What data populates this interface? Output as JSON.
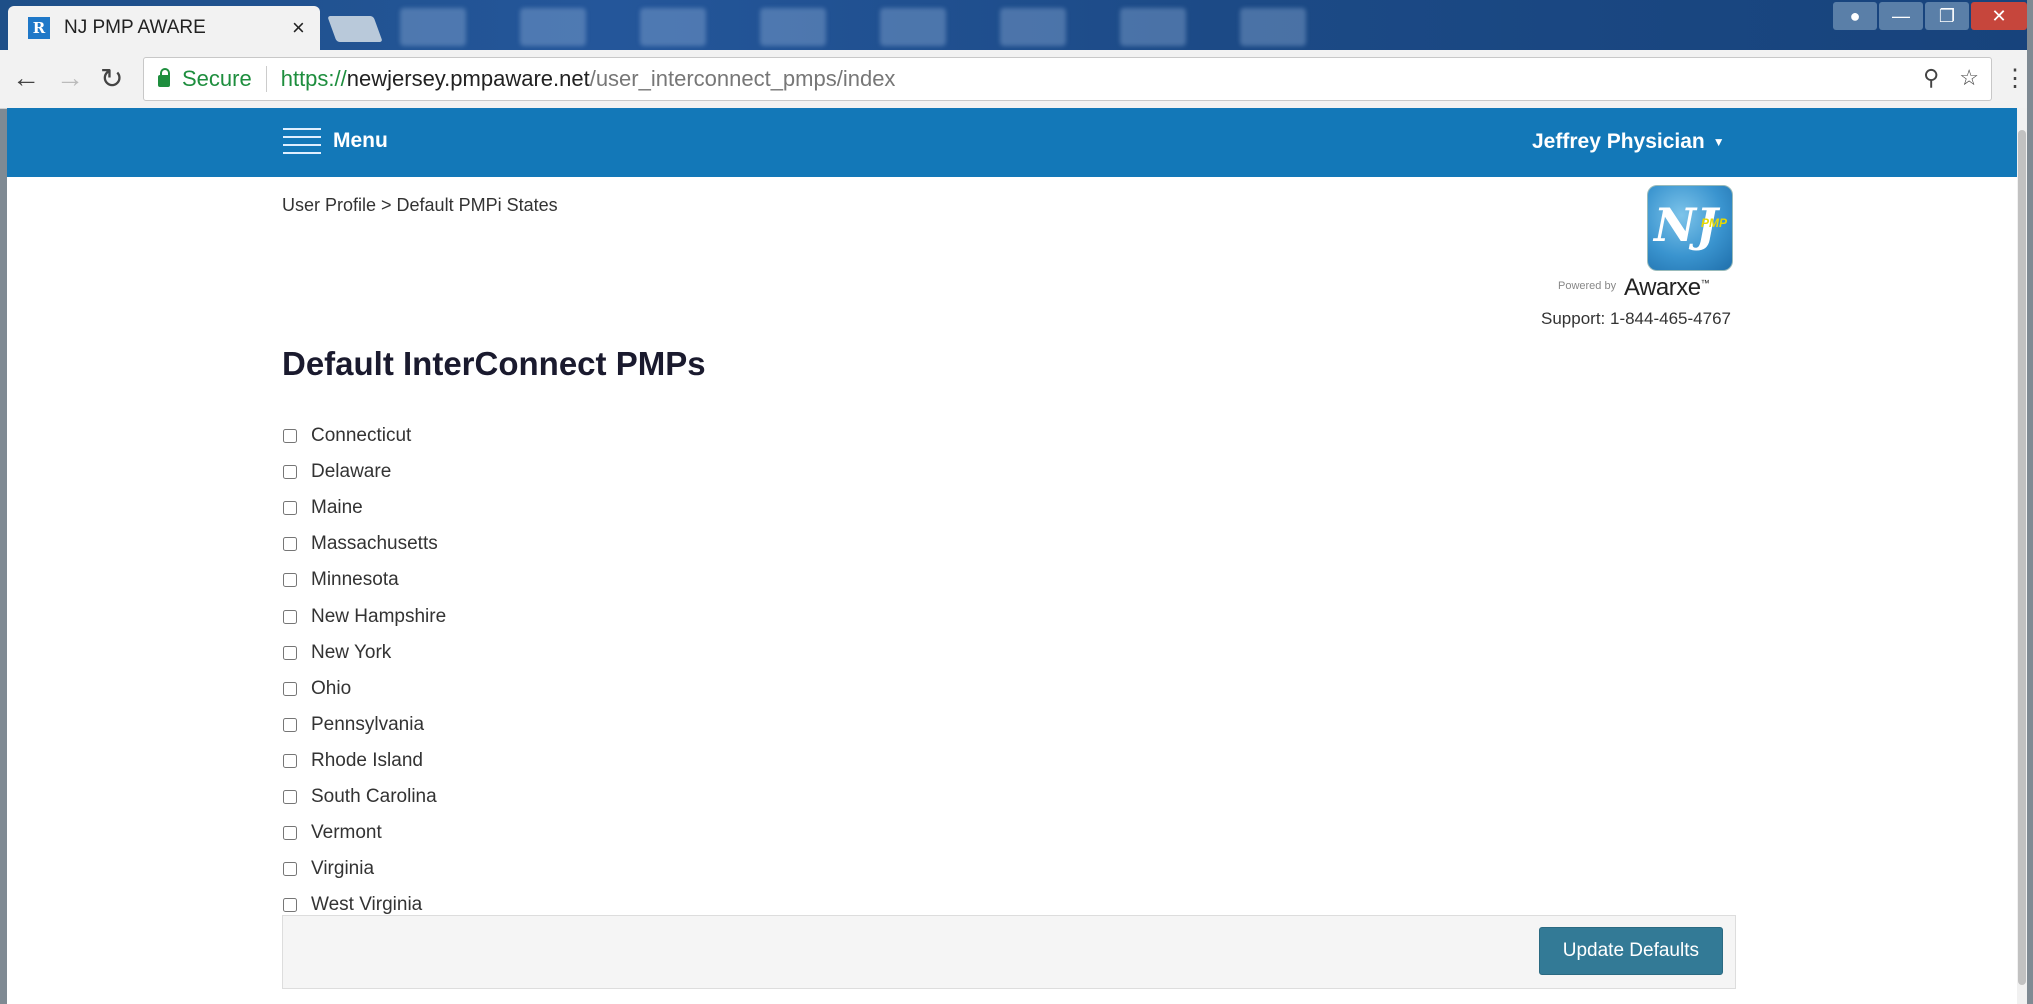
{
  "browser": {
    "tab_title": "NJ PMP AWARE",
    "tab_close": "×",
    "favicon_text": "R",
    "secure_label": "Secure",
    "url_scheme": "https://",
    "url_host": "newjersey.pmpaware.net",
    "url_path": "/user_interconnect_pmps/index"
  },
  "header": {
    "menu_label": "Menu",
    "user_name": "Jeffrey Physician"
  },
  "branding": {
    "logo_text": "NJ",
    "logo_badge": "PMP",
    "powered_by": "Powered by",
    "awarxe": "Awarxe",
    "support": "Support: 1-844-465-4767"
  },
  "breadcrumb": "User Profile > Default PMPi States",
  "page_title": "Default InterConnect PMPs",
  "states": [
    {
      "label": "Connecticut",
      "checked": false
    },
    {
      "label": "Delaware",
      "checked": false
    },
    {
      "label": "Maine",
      "checked": false
    },
    {
      "label": "Massachusetts",
      "checked": false
    },
    {
      "label": "Minnesota",
      "checked": false
    },
    {
      "label": "New Hampshire",
      "checked": false
    },
    {
      "label": "New York",
      "checked": false
    },
    {
      "label": "Ohio",
      "checked": false
    },
    {
      "label": "Pennsylvania",
      "checked": false
    },
    {
      "label": "Rhode Island",
      "checked": false
    },
    {
      "label": "South Carolina",
      "checked": false
    },
    {
      "label": "Vermont",
      "checked": false
    },
    {
      "label": "Virginia",
      "checked": false
    },
    {
      "label": "West Virginia",
      "checked": false
    }
  ],
  "actions": {
    "update_label": "Update Defaults"
  },
  "colors": {
    "header_bg": "#1378b8",
    "button_bg": "#337a96"
  }
}
